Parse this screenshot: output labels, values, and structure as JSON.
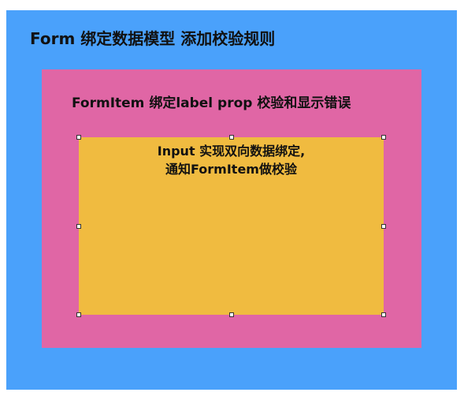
{
  "form": {
    "title": "Form  绑定数据模型 添加校验规则",
    "color": "#4aa1fb"
  },
  "form_item": {
    "title": "FormItem 绑定label prop  校验和显示错误",
    "color": "#e066a5"
  },
  "input": {
    "line1": "Input 实现双向数据绑定,",
    "line2": "通知FormItem做校验",
    "color": "#f0bb40"
  }
}
